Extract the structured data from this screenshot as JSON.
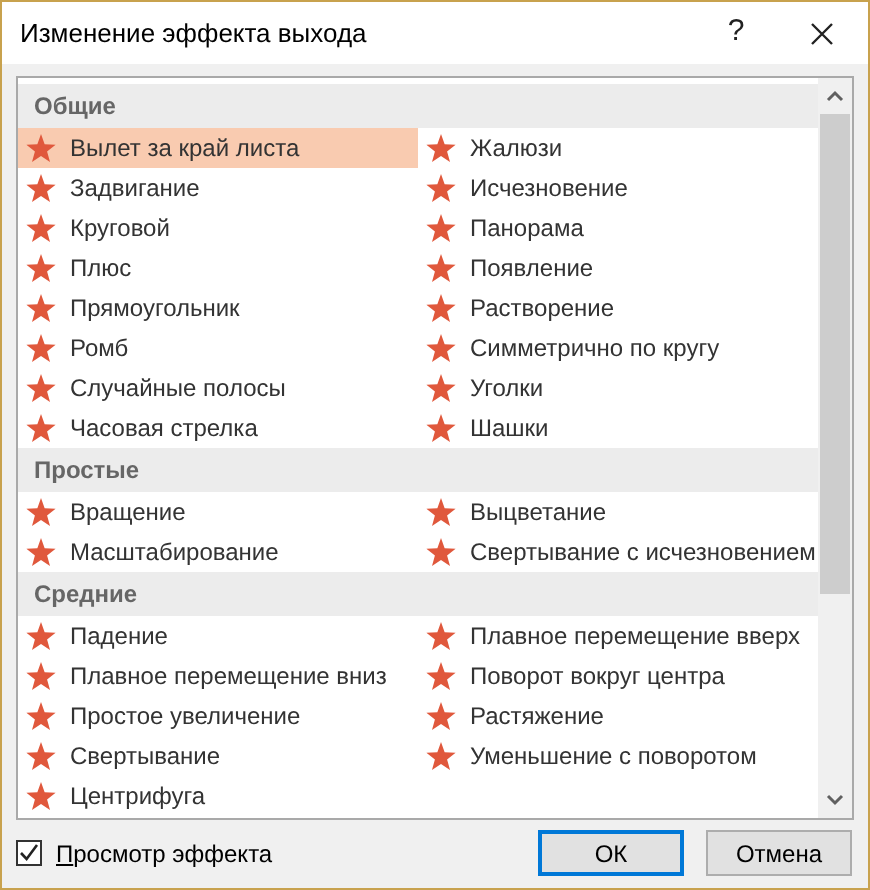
{
  "window": {
    "title": "Изменение эффекта выхода",
    "help": "?"
  },
  "groups": [
    {
      "label": "Общие",
      "items": [
        {
          "label": "Вылет за край листа",
          "selected": true
        },
        {
          "label": "Жалюзи",
          "selected": false
        },
        {
          "label": "Задвигание",
          "selected": false
        },
        {
          "label": "Исчезновение",
          "selected": false
        },
        {
          "label": "Круговой",
          "selected": false
        },
        {
          "label": "Панорама",
          "selected": false
        },
        {
          "label": "Плюс",
          "selected": false
        },
        {
          "label": "Появление",
          "selected": false
        },
        {
          "label": "Прямоугольник",
          "selected": false
        },
        {
          "label": "Растворение",
          "selected": false
        },
        {
          "label": "Ромб",
          "selected": false
        },
        {
          "label": "Симметрично по кругу",
          "selected": false
        },
        {
          "label": "Случайные полосы",
          "selected": false
        },
        {
          "label": "Уголки",
          "selected": false
        },
        {
          "label": "Часовая стрелка",
          "selected": false
        },
        {
          "label": "Шашки",
          "selected": false
        }
      ]
    },
    {
      "label": "Простые",
      "items": [
        {
          "label": "Вращение",
          "selected": false
        },
        {
          "label": "Выцветание",
          "selected": false
        },
        {
          "label": "Масштабирование",
          "selected": false
        },
        {
          "label": "Свертывание с исчезновением",
          "selected": false
        }
      ]
    },
    {
      "label": "Средние",
      "items": [
        {
          "label": "Падение",
          "selected": false
        },
        {
          "label": "Плавное перемещение вверх",
          "selected": false
        },
        {
          "label": "Плавное перемещение вниз",
          "selected": false
        },
        {
          "label": "Поворот вокруг центра",
          "selected": false
        },
        {
          "label": "Простое увеличение",
          "selected": false
        },
        {
          "label": "Растяжение",
          "selected": false
        },
        {
          "label": "Свертывание",
          "selected": false
        },
        {
          "label": "Уменьшение с поворотом",
          "selected": false
        },
        {
          "label": "Центрифуга",
          "selected": false
        }
      ]
    }
  ],
  "preview": {
    "label": "Просмотр эффекта",
    "checked": true
  },
  "buttons": [
    {
      "label": "ОК",
      "default": true
    },
    {
      "label": "Отмена",
      "default": false
    }
  ]
}
